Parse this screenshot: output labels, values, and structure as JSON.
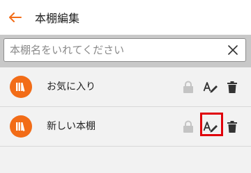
{
  "header": {
    "title": "本棚編集",
    "back_icon": "arrow-left-icon",
    "accent_color": "#f26c17"
  },
  "search": {
    "placeholder": "本棚名をいれてください",
    "value": "",
    "clear_icon": "close-icon"
  },
  "shelves": [
    {
      "label": "お気に入り",
      "icon": "books-icon",
      "lock_icon": "lock-icon",
      "edit_icon": "rename-icon",
      "delete_icon": "trash-icon",
      "highlighted": false
    },
    {
      "label": "新しい本棚",
      "icon": "books-icon",
      "lock_icon": "lock-icon",
      "edit_icon": "rename-icon",
      "delete_icon": "trash-icon",
      "highlighted": true
    }
  ],
  "colors": {
    "highlight": "#e0000b",
    "icon_circle": "#f26c17",
    "lock_disabled": "#c4c4c4",
    "icon_dark": "#333333"
  }
}
